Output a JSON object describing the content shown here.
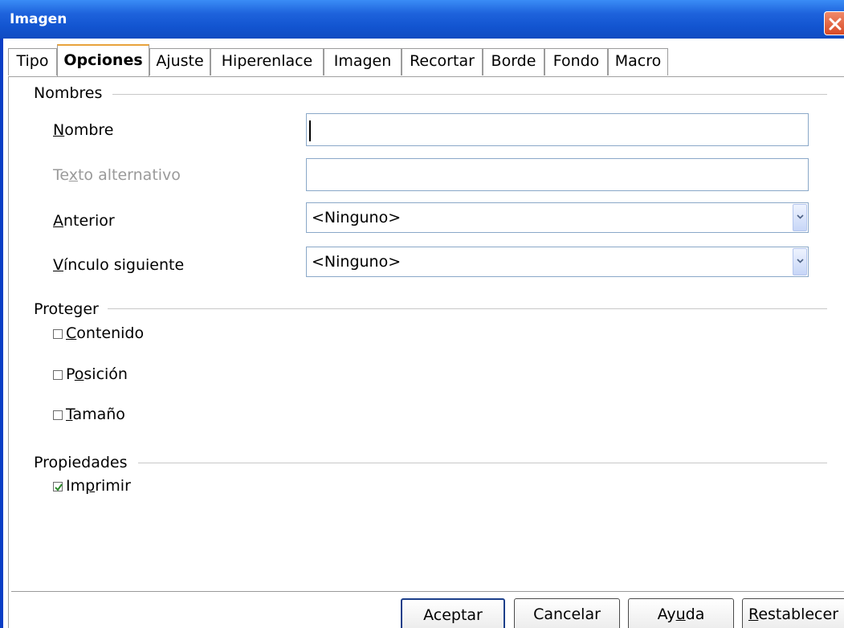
{
  "window": {
    "title": "Imagen",
    "close_icon": "close-icon"
  },
  "tabs": [
    {
      "label": "Tipo",
      "active": false
    },
    {
      "label": "Opciones",
      "active": true
    },
    {
      "label": "Ajuste",
      "active": false
    },
    {
      "label": "Hiperenlace",
      "active": false
    },
    {
      "label": "Imagen",
      "active": false
    },
    {
      "label": "Recortar",
      "active": false
    },
    {
      "label": "Borde",
      "active": false
    },
    {
      "label": "Fondo",
      "active": false
    },
    {
      "label": "Macro",
      "active": false
    }
  ],
  "nombres": {
    "header": "Nombres",
    "nombre": {
      "label_pre": "",
      "label_mnemonic": "N",
      "label_post": "ombre",
      "value": ""
    },
    "texto_alternativo": {
      "label_pre": "Te",
      "label_mnemonic": "x",
      "label_post": "to alternativo",
      "value": "",
      "disabled": true
    },
    "anterior": {
      "label_pre": "",
      "label_mnemonic": "A",
      "label_post": "nterior",
      "selected": "<Ninguno>"
    },
    "vinculo_siguiente": {
      "label_pre": "",
      "label_mnemonic": "V",
      "label_post": "ínculo siguiente",
      "selected": "<Ninguno>"
    }
  },
  "proteger": {
    "header": "Proteger",
    "contenido": {
      "label_pre": "",
      "label_mnemonic": "C",
      "label_post": "ontenido",
      "checked": false
    },
    "posicion": {
      "label_pre": "P",
      "label_mnemonic": "o",
      "label_post": "sición",
      "checked": false
    },
    "tamano": {
      "label_pre": "",
      "label_mnemonic": "T",
      "label_post": "amaño",
      "checked": false
    }
  },
  "propiedades": {
    "header": "Propiedades",
    "imprimir": {
      "label_pre": "Im",
      "label_mnemonic": "p",
      "label_post": "rimir",
      "checked": true
    }
  },
  "buttons": {
    "aceptar": "Aceptar",
    "cancelar": "Cancelar",
    "ayuda_pre": "Ay",
    "ayuda_mnemonic": "u",
    "ayuda_post": "da",
    "restablecer_pre": "",
    "restablecer_mnemonic": "R",
    "restablecer_post": "establecer"
  },
  "colors": {
    "titlebar": "#1254d0",
    "active_tab_accent": "#e8a23b",
    "frame": "#0a3ec5"
  }
}
